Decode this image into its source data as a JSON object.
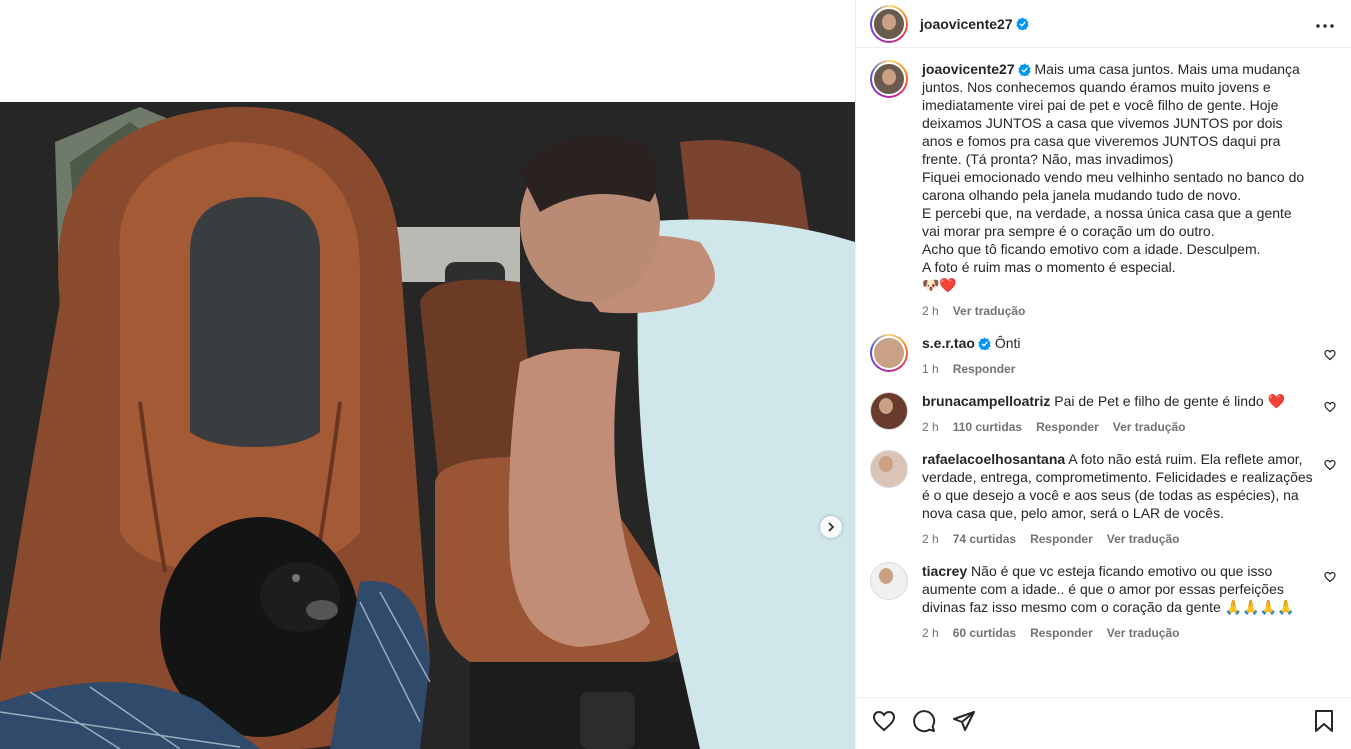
{
  "colors": {
    "accent": "#0095f6",
    "like_red": "#ed4956",
    "muted": "#737373",
    "text": "#262626"
  },
  "post": {
    "username": "joaovicente27",
    "verified": true
  },
  "caption": {
    "username": "joaovicente27",
    "text": "Mais uma casa juntos. Mais uma mudança juntos. Nos conhecemos quando éramos muito jovens e imediatamente virei pai de pet e você filho de gente. Hoje deixamos JUNTOS a casa que vivemos JUNTOS por dois anos e fomos pra casa que viveremos JUNTOS daqui pra frente. (Tá pronta? Não, mas invadimos)\nFiquei emocionado vendo meu velhinho sentado no banco do carona olhando pela janela mudando tudo de novo.\nE percebi que, na verdade, a nossa única casa que a gente vai morar pra sempre é o coração um do outro.\nAcho que tô ficando emotivo com a idade. Desculpem.\nA foto é ruim mas o momento é especial.\n🐶❤️",
    "time": "2 h",
    "translate": "Ver tradução"
  },
  "comments": [
    {
      "username": "s.e.r.tao",
      "verified": true,
      "text": "Ônti",
      "time": "1 h",
      "likes": "",
      "reply": "Responder",
      "translate": "",
      "ring": true
    },
    {
      "username": "brunacampelloatriz",
      "verified": false,
      "text": "Pai de Pet e filho de gente é lindo ❤️",
      "time": "2 h",
      "likes": "110 curtidas",
      "reply": "Responder",
      "translate": "Ver tradução",
      "ring": false
    },
    {
      "username": "rafaelacoelhosantana",
      "verified": false,
      "text": "A foto não está ruim. Ela reflete amor, verdade, entrega, comprometimento. Felicidades e realizações é o que desejo a você e aos seus (de todas as espécies), na nova casa que, pelo amor, será o LAR de vocês.",
      "time": "2 h",
      "likes": "74 curtidas",
      "reply": "Responder",
      "translate": "Ver tradução",
      "ring": false
    },
    {
      "username": "tiacrey",
      "verified": false,
      "text": "Não é que vc esteja ficando emotivo ou que isso aumente com a idade.. é que o amor por essas perfeições divinas faz isso mesmo com o coração da gente 🙏🙏🙏🙏",
      "time": "2 h",
      "likes": "60 curtidas",
      "reply": "Responder",
      "translate": "Ver tradução",
      "ring": false
    }
  ],
  "icons": {
    "like": "heart-icon",
    "comment": "comment-icon",
    "share": "share-icon",
    "save": "bookmark-icon",
    "more": "more-icon",
    "next": "chevron-right-icon"
  }
}
